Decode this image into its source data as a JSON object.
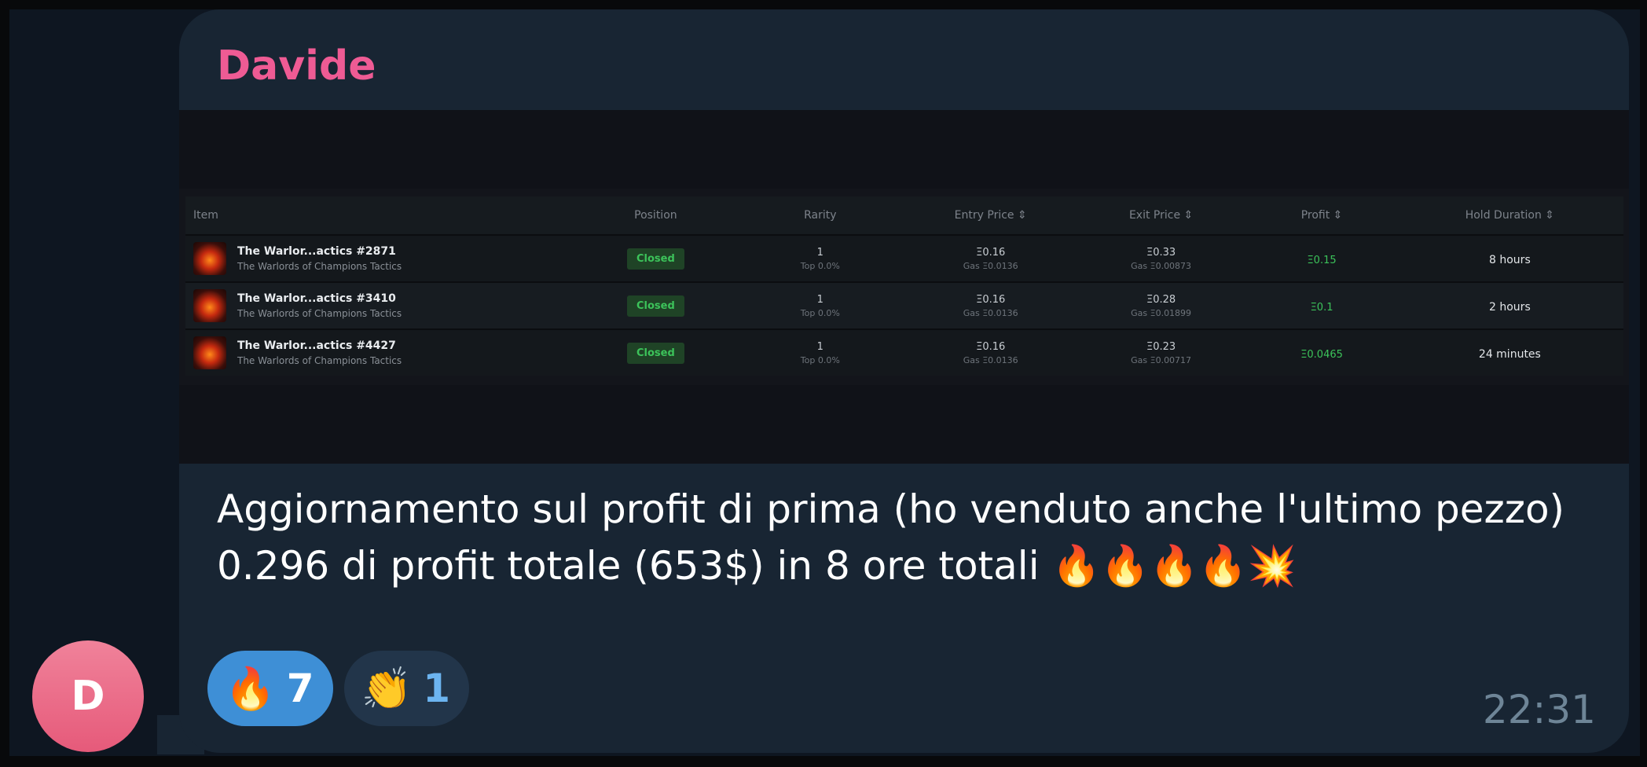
{
  "message": {
    "sender": "Davide",
    "avatar_letter": "D",
    "text": "Aggiornamento sul profit di prima (ho venduto anche l'ultimo pezzo) 0.296 di profit totale (653$) in 8 ore totali 🔥🔥🔥🔥💥",
    "time": "22:31",
    "reactions": [
      {
        "emoji": "🔥",
        "count": "7"
      },
      {
        "emoji": "👏",
        "count": "1"
      }
    ]
  },
  "table": {
    "headers": {
      "item": "Item",
      "position": "Position",
      "rarity": "Rarity",
      "entry": "Entry Price ⇕",
      "exit": "Exit Price ⇕",
      "profit": "Profit ⇕",
      "hold": "Hold Duration ⇕"
    },
    "rows": [
      {
        "name": "The Warlor...actics #2871",
        "collection": "The Warlords of Champions Tactics",
        "position": "Closed",
        "rarity": "1",
        "rarity_sub": "Top 0.0%",
        "entry": "Ξ0.16",
        "entry_gas": "Gas Ξ0.0136",
        "exit": "Ξ0.33",
        "exit_gas": "Gas Ξ0.00873",
        "profit": "Ξ0.15",
        "hold": "8 hours"
      },
      {
        "name": "The Warlor...actics #3410",
        "collection": "The Warlords of Champions Tactics",
        "position": "Closed",
        "rarity": "1",
        "rarity_sub": "Top 0.0%",
        "entry": "Ξ0.16",
        "entry_gas": "Gas Ξ0.0136",
        "exit": "Ξ0.28",
        "exit_gas": "Gas Ξ0.01899",
        "profit": "Ξ0.1",
        "hold": "2 hours"
      },
      {
        "name": "The Warlor...actics #4427",
        "collection": "The Warlords of Champions Tactics",
        "position": "Closed",
        "rarity": "1",
        "rarity_sub": "Top 0.0%",
        "entry": "Ξ0.16",
        "entry_gas": "Gas Ξ0.0136",
        "exit": "Ξ0.23",
        "exit_gas": "Gas Ξ0.00717",
        "profit": "Ξ0.0465",
        "hold": "24 minutes"
      }
    ]
  },
  "colors": {
    "sender": "#ee5b94",
    "bubble": "#182533",
    "reaction_active": "#3e8fd6",
    "profit_green": "#3cc35a"
  }
}
